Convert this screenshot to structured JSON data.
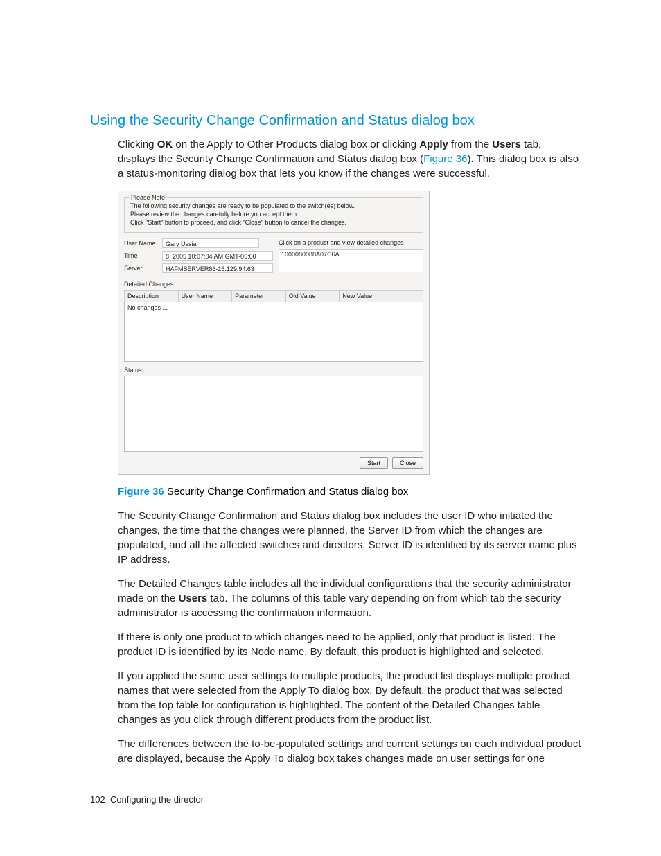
{
  "heading": "Using the Security Change Confirmation and Status dialog box",
  "intro": {
    "p1a": "Clicking ",
    "p1b": "OK",
    "p1c": " on the Apply to Other Products dialog box or clicking ",
    "p1d": "Apply",
    "p1e": " from the ",
    "p1f": "Users",
    "p1g": " tab, displays the Security Change Confirmation and Status dialog box (",
    "p1h": "Figure 36",
    "p1i": "). This dialog box is also a status-monitoring dialog box that lets you know if the changes were successful."
  },
  "dialog": {
    "legend": "Please Note",
    "note_line1": "The following security changes are ready to be populated to the switch(es) below.",
    "note_line2": "Please review the changes carefully before you accept them.",
    "note_line3": "Click \"Start\" button to proceed, and click \"Close\" button to cancel the changes.",
    "labels": {
      "user": "User Name",
      "time": "Time",
      "server": "Server"
    },
    "user": "Gary Ussia",
    "time": "8, 2005 10:07:04 AM GMT-05:00",
    "server": "HAFMSERVER86-16.129.94.63",
    "product_label": "Click on a product and view detailed changes",
    "product_value": "1000080088A07C6A",
    "detailed_label": "Detailed Changes",
    "table_headers": {
      "c0": "Description",
      "c1": "User Name",
      "c2": "Parameter",
      "c3": "Old Value",
      "c4": "New Value"
    },
    "no_changes": "No changes ...",
    "status_label": "Status",
    "buttons": {
      "start": "Start",
      "close": "Close"
    }
  },
  "caption": {
    "label": "Figure 36",
    "text": " Security Change Confirmation and Status dialog box"
  },
  "para2": "The Security Change Confirmation and Status dialog box includes the user ID who initiated the changes, the time that the changes were planned, the Server ID from which the changes are populated, and all the affected switches and directors. Server ID is identified by its server name plus IP address.",
  "para3a": "The Detailed Changes table includes all the individual configurations that the security administrator made on the ",
  "para3b": "Users",
  "para3c": " tab. The columns of this table vary depending on from which tab the security administrator is accessing the confirmation information.",
  "para4": "If there is only one product to which changes need to be applied, only that product is listed. The product ID is identified by its Node name. By default, this product is highlighted and selected.",
  "para5": "If you applied the same user settings to multiple products, the product list displays multiple product names that were selected from the Apply To dialog box. By default, the product that was selected from the top table for configuration is highlighted. The content of the Detailed Changes table changes as you click through different products from the product list.",
  "para6": "The differences between the to-be-populated settings and current settings on each individual product are displayed, because the Apply To dialog box takes changes made on user settings for one",
  "footer": {
    "page": "102",
    "title": "Configuring the director"
  }
}
